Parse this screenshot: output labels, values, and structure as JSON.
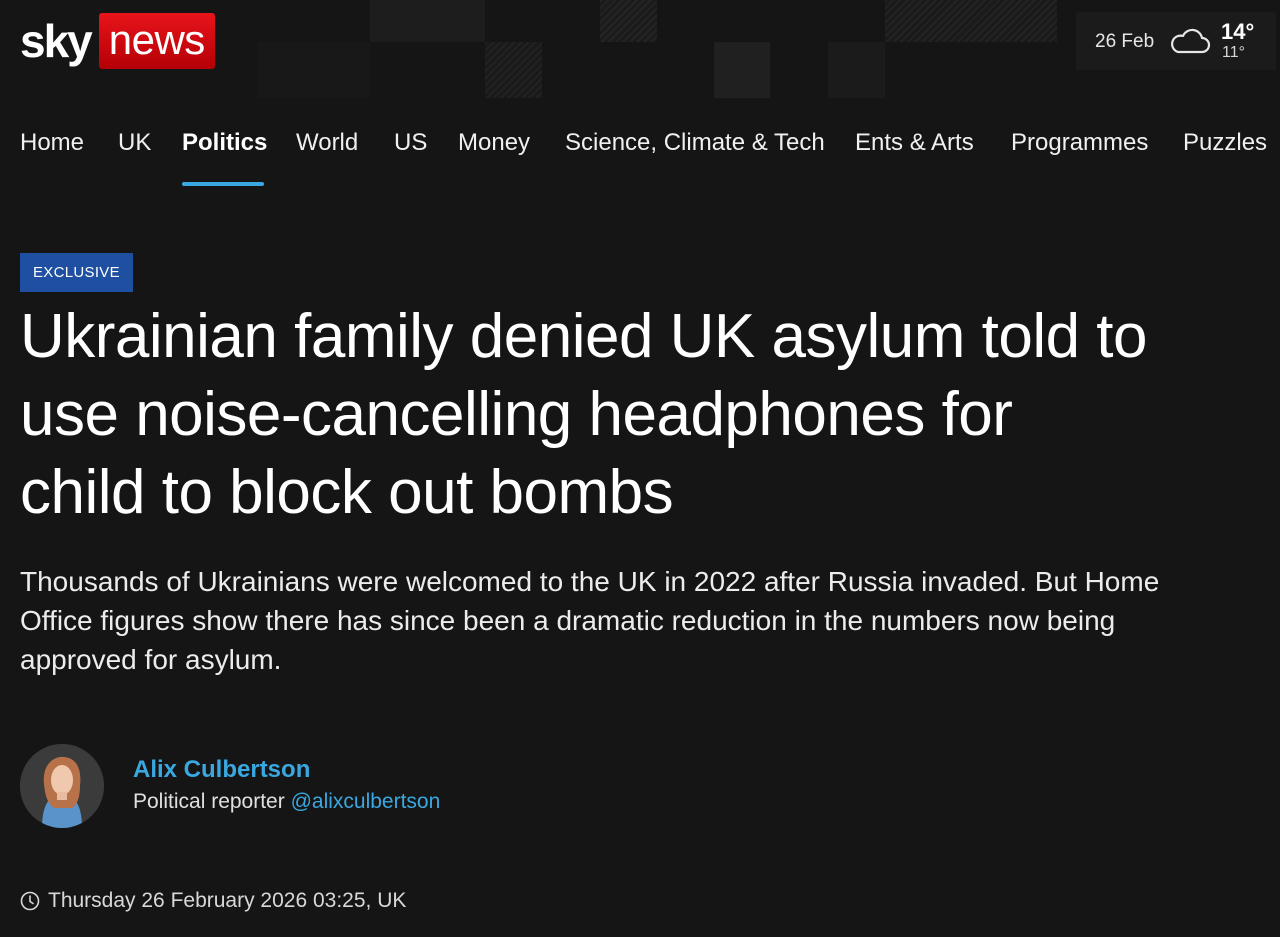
{
  "logo": {
    "sky": "sky",
    "news": "news"
  },
  "weather": {
    "date": "26 Feb",
    "high": "14°",
    "low": "11°",
    "icon": "cloud-icon"
  },
  "nav": {
    "items": [
      {
        "label": "Home"
      },
      {
        "label": "UK"
      },
      {
        "label": "Politics",
        "active": true
      },
      {
        "label": "World"
      },
      {
        "label": "US"
      },
      {
        "label": "Money"
      },
      {
        "label": "Science, Climate & Tech"
      },
      {
        "label": "Ents & Arts"
      },
      {
        "label": "Programmes"
      },
      {
        "label": "Puzzles"
      }
    ]
  },
  "article": {
    "badge": "EXCLUSIVE",
    "headline_lines": [
      "Ukrainian family denied UK asylum told to",
      "use noise-cancelling headphones for",
      "child to block out bombs"
    ],
    "standfirst_lines": [
      "Thousands of Ukrainians were welcomed to the UK in 2022 after Russia invaded. But Home",
      "Office figures show there has since been a dramatic reduction in the numbers now being",
      "approved for asylum."
    ],
    "author": {
      "name": "Alix Culbertson",
      "role": "Political reporter",
      "handle": "@alixculbertson"
    },
    "timestamp": "Thursday 26 February 2026 03:25, UK"
  },
  "colors": {
    "background": "#151515",
    "accent_blue": "#3aa8e0",
    "badge_blue": "#1f4fa0",
    "brand_red": "#d8121a"
  }
}
